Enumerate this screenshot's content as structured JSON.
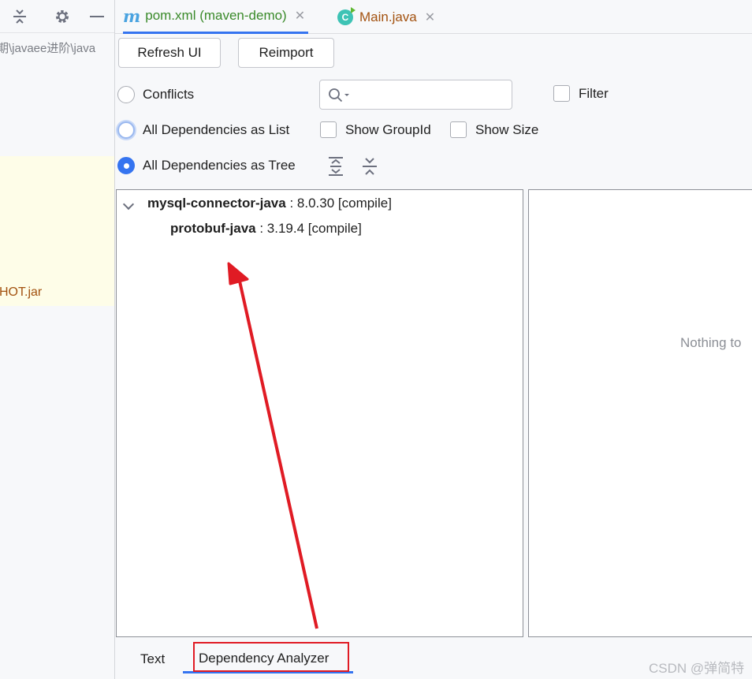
{
  "left_panel": {
    "path_fragment": "期\\javaee进阶\\java",
    "jar_fragment": "HOT.jar"
  },
  "tabs": [
    {
      "label": "pom.xml (maven-demo)",
      "icon": "maven-icon",
      "icon_text": "m",
      "active": true,
      "color": "#3a8a2a"
    },
    {
      "label": "Main.java",
      "icon": "java-class-icon",
      "icon_text": "C",
      "active": false,
      "color": "#a35210"
    }
  ],
  "close_glyph": "✕",
  "toolbar": {
    "refresh_label": "Refresh UI",
    "reimport_label": "Reimport"
  },
  "options": {
    "conflicts_label": "Conflicts",
    "as_list_label": "All Dependencies as List",
    "as_tree_label": "All Dependencies as Tree",
    "selected": "as_tree",
    "search_value": "",
    "filter_label": "Filter",
    "show_groupid_label": "Show GroupId",
    "show_size_label": "Show Size"
  },
  "tree": [
    {
      "name": "mysql-connector-java",
      "detail": " : 8.0.30 [compile]",
      "expanded": true
    },
    {
      "name": "protobuf-java",
      "detail": " : 3.19.4 [compile]"
    }
  ],
  "details_pane": {
    "empty_text": "Nothing to"
  },
  "bottom_tabs": [
    {
      "label": "Text",
      "active": false
    },
    {
      "label": "Dependency Analyzer",
      "active": true
    }
  ],
  "watermark": "CSDN @弹简特",
  "colors": {
    "accent": "#3574f0",
    "annotation": "#e01b24"
  }
}
